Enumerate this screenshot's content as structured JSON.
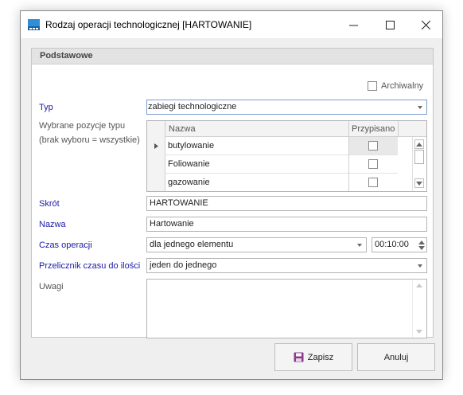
{
  "window": {
    "title": "Rodzaj operacji technologicznej [HARTOWANIE]",
    "controls": [
      "minimize-icon",
      "maximize-icon",
      "close-icon"
    ]
  },
  "group": {
    "title": "Podstawowe",
    "archived_label": "Archiwalny",
    "archived_checked": false
  },
  "form": {
    "typ_label": "Typ",
    "typ_value": "zabiegi technologiczne",
    "pozycje_label_1": "Wybrane pozycje typu",
    "pozycje_label_2": "(brak wyboru = wszystkie)",
    "grid": {
      "col_nazwa": "Nazwa",
      "col_przypisano": "Przypisano",
      "rows": [
        {
          "nazwa": "butylowanie",
          "przypisano": false
        },
        {
          "nazwa": "Foliowanie",
          "przypisano": false
        },
        {
          "nazwa": "gazowanie",
          "przypisano": false
        }
      ]
    },
    "skrot_label": "Skrót",
    "skrot_value": "HARTOWANIE",
    "nazwa_label": "Nazwa",
    "nazwa_value": "Hartowanie",
    "czas_label": "Czas operacji",
    "czas_value": "dla jednego elementu",
    "czas_time": "00:10:00",
    "przelicznik_label": "Przelicznik czasu do ilości",
    "przelicznik_value": "jeden do jednego",
    "uwagi_label": "Uwagi",
    "uwagi_value": ""
  },
  "buttons": {
    "save_label": "Zapisz",
    "cancel_label": "Anuluj"
  },
  "colors": {
    "label_blue": "#1a1aa8",
    "save_icon": "#8b3a8b"
  }
}
